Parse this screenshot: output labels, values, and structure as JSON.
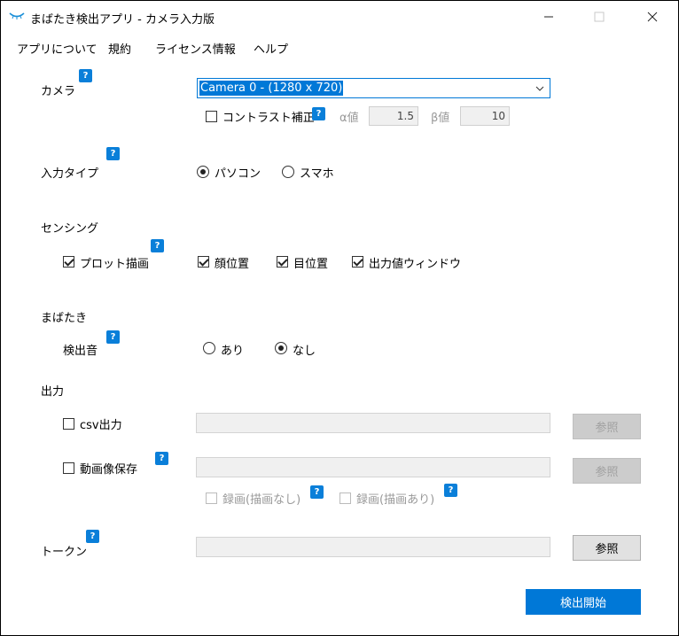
{
  "window": {
    "title": "まばたき検出アプリ - カメラ入力版",
    "minimize_icon": "minimize-icon",
    "maximize_icon": "maximize-icon",
    "close_icon": "close-icon"
  },
  "menu": [
    "アプリについて",
    "規約",
    "ライセンス情報",
    "ヘルプ"
  ],
  "help_label": "?",
  "camera": {
    "label": "カメラ",
    "selected": "Camera 0 - (1280 x 720)",
    "contrast_label": "コントラスト補正",
    "alpha_label": "α値",
    "alpha_value": "1.5",
    "beta_label": "β値",
    "beta_value": "10"
  },
  "input_type": {
    "label": "入力タイプ",
    "options": [
      "パソコン",
      "スマホ"
    ],
    "selected": "パソコン"
  },
  "sensing": {
    "label": "センシング",
    "plot_label": "プロット描画",
    "options": [
      "顔位置",
      "目位置",
      "出力値ウィンドウ"
    ]
  },
  "blink": {
    "label": "まばたき",
    "sound_label": "検出音",
    "options": [
      "あり",
      "なし"
    ],
    "selected": "なし"
  },
  "output": {
    "label": "出力",
    "csv_label": "csv出力",
    "video_label": "動画像保存",
    "browse_label": "参照",
    "record_no_draw": "録画(描画なし)",
    "record_draw": "録画(描画あり)"
  },
  "token": {
    "label": "トークン",
    "browse_label": "参照"
  },
  "start_button": "検出開始",
  "colors": {
    "accent": "#0078d7",
    "help": "#0a7fd9"
  }
}
